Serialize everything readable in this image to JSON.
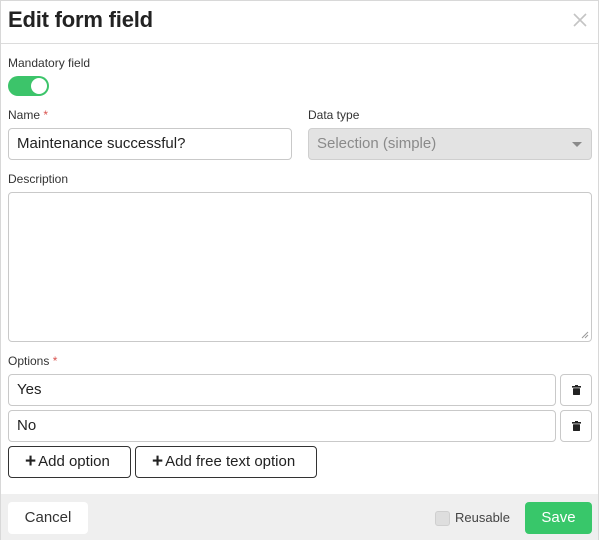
{
  "dialog": {
    "title": "Edit form field"
  },
  "mandatory": {
    "label": "Mandatory field",
    "enabled": true
  },
  "name": {
    "label": "Name",
    "required_marker": "*",
    "value": "Maintenance successful?"
  },
  "data_type": {
    "label": "Data type",
    "value": "Selection (simple)"
  },
  "description": {
    "label": "Description",
    "value": ""
  },
  "options": {
    "label": "Options",
    "required_marker": "*",
    "items": [
      {
        "value": "Yes"
      },
      {
        "value": "No"
      }
    ],
    "add_option_label": "Add option",
    "add_free_text_label": "Add free text option"
  },
  "footer": {
    "cancel_label": "Cancel",
    "reusable_label": "Reusable",
    "reusable_checked": false,
    "save_label": "Save"
  },
  "colors": {
    "accent_green": "#38c76a",
    "required_red": "#d9534f"
  }
}
